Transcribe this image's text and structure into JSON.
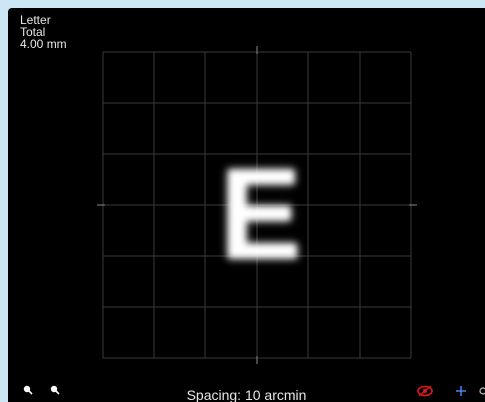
{
  "info": {
    "line1": "Letter",
    "line2": "Total",
    "line3": "4.00 mm"
  },
  "target": {
    "letter": "E"
  },
  "footer": {
    "spacing_label": "Spacing:  10 arcmin"
  },
  "icons": {
    "zoom_in": "zoom-in-icon",
    "zoom_out": "zoom-out-icon",
    "target": "target-icon",
    "crosshair": "crosshair-icon"
  },
  "colors": {
    "background": "#000000",
    "grid": "#3a3a3a",
    "accent_red": "#e01818",
    "accent_blue": "#4a8cff"
  }
}
